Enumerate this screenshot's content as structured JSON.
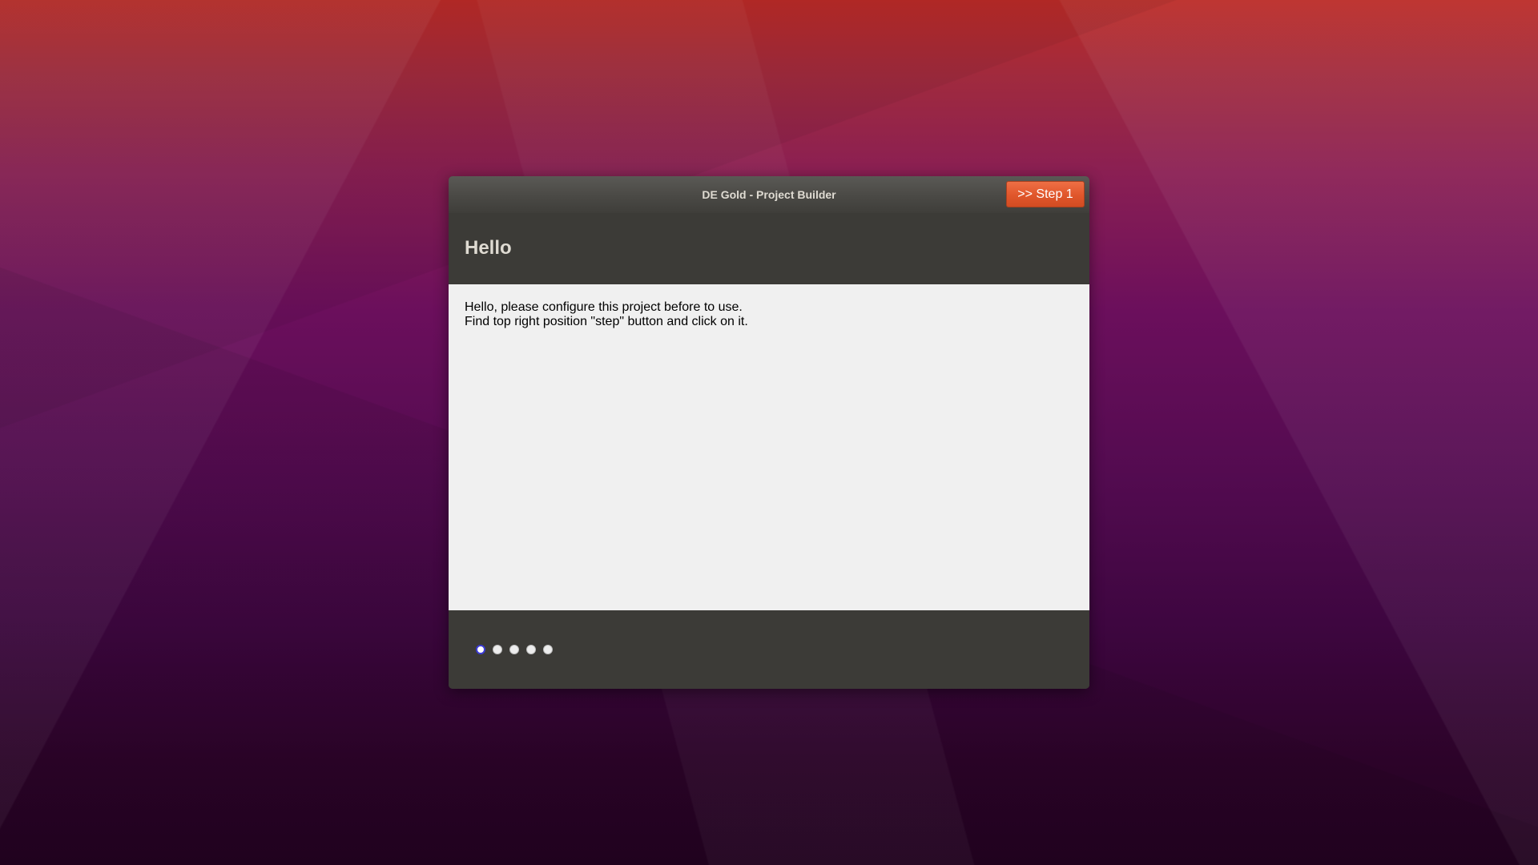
{
  "window": {
    "title": "DE Gold - Project Builder",
    "step_button_label": ">> Step 1"
  },
  "page": {
    "title": "Hello",
    "lines": [
      "Hello, please configure this project before to use.",
      "Find top right position \"step\" button and click on it."
    ]
  },
  "steps": {
    "total": 5,
    "current": 1
  },
  "colors": {
    "accent": "#e0562b",
    "active_dot_border": "#3b3bd6",
    "panel_dark": "#3c3b37",
    "content_bg": "#f0f0f0"
  }
}
